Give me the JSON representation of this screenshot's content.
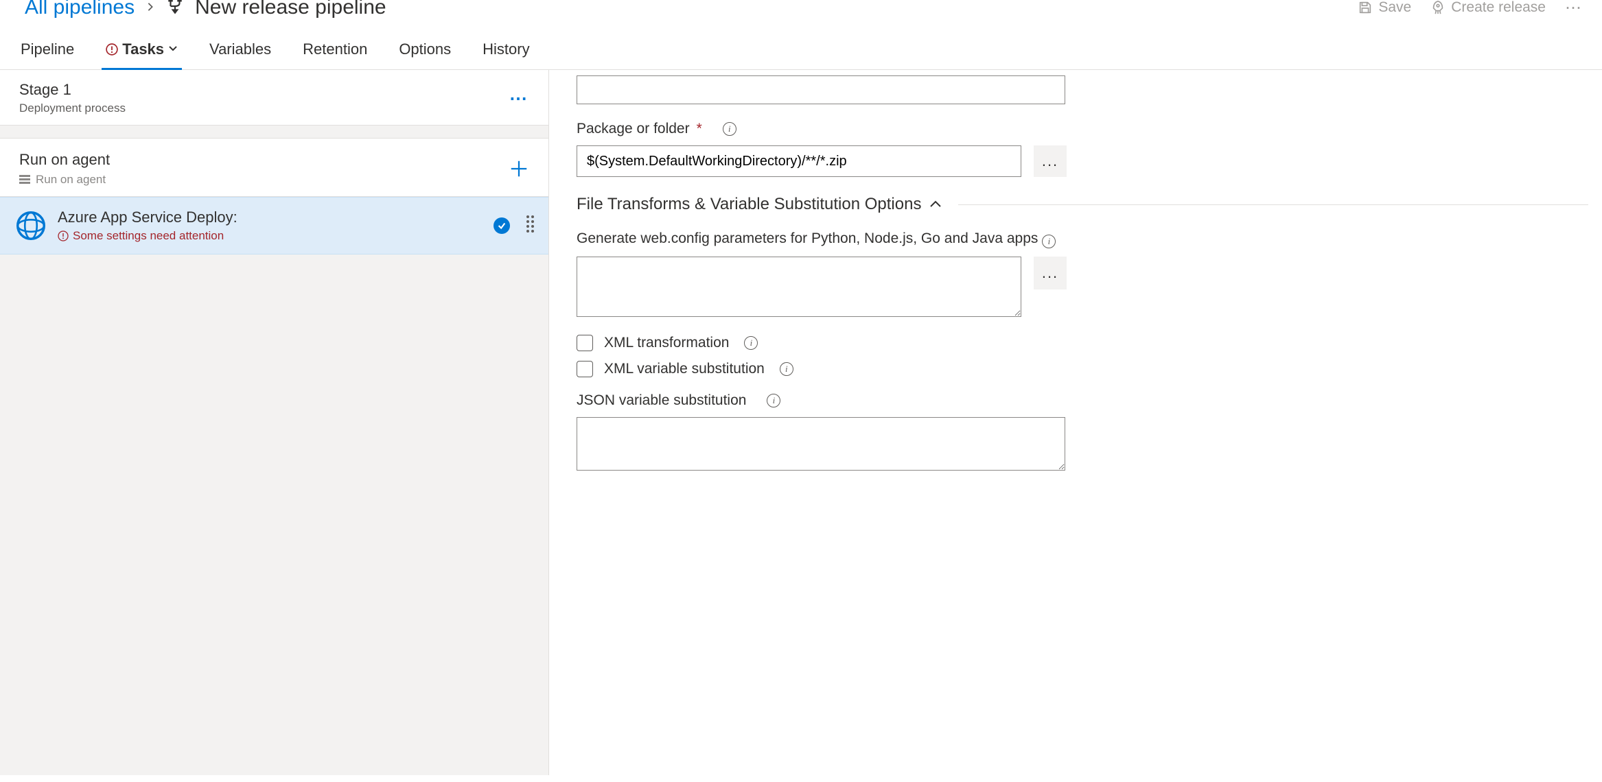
{
  "breadcrumb": {
    "all_pipelines": "All pipelines",
    "title": "New release pipeline"
  },
  "actions": {
    "save": "Save",
    "create_release": "Create release"
  },
  "tabs": {
    "pipeline": "Pipeline",
    "tasks": "Tasks",
    "variables": "Variables",
    "retention": "Retention",
    "options": "Options",
    "history": "History"
  },
  "stage": {
    "title": "Stage 1",
    "sub": "Deployment process"
  },
  "agent": {
    "title": "Run on agent",
    "sub": "Run on agent"
  },
  "task": {
    "title": "Azure App Service Deploy:",
    "warn": "Some settings need attention"
  },
  "form": {
    "package_label": "Package or folder",
    "package_value": "$(System.DefaultWorkingDirectory)/**/*.zip",
    "section": "File Transforms & Variable Substitution Options",
    "webconfig_label": "Generate web.config parameters for Python, Node.js, Go and Java apps",
    "webconfig_value": "",
    "xml_transformation": "XML transformation",
    "xml_varsub": "XML variable substitution",
    "json_varsub": "JSON variable substitution",
    "json_value": ""
  }
}
